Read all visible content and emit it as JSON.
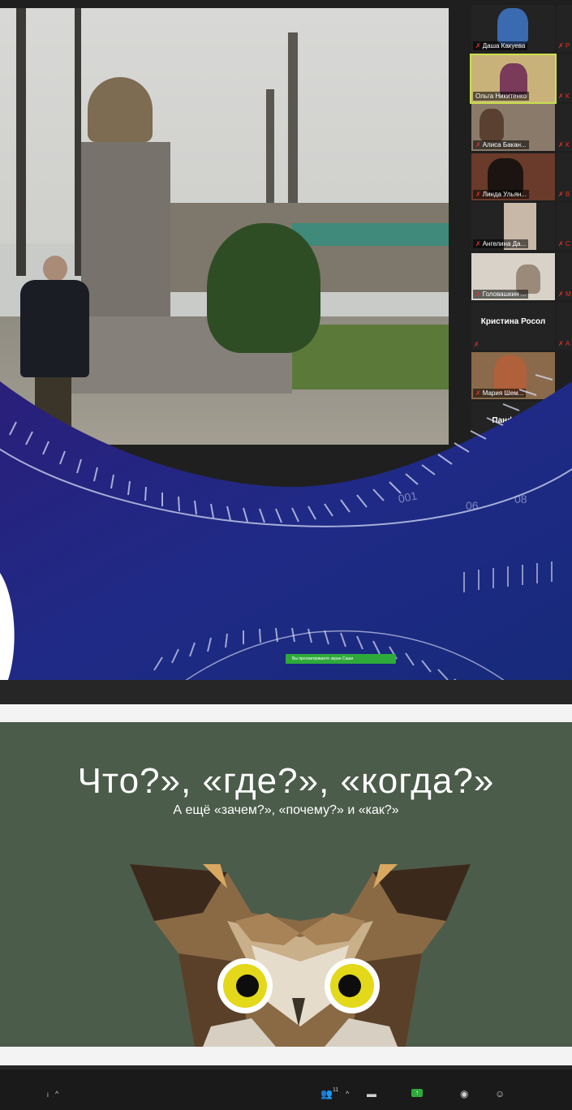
{
  "participants": [
    {
      "name": "Даша Какуева"
    },
    {
      "name": "Ольга Никитенко"
    },
    {
      "name": "Алиса Бакан..."
    },
    {
      "name": "Линда Ульян..."
    },
    {
      "name": "Ангелина Да..."
    },
    {
      "name": "Головашкин ..."
    },
    {
      "name": "Кристина Росол"
    },
    {
      "name": "Мария Шем..."
    },
    {
      "name": "Панфилов"
    }
  ],
  "right_column_initials": [
    "Р",
    "К",
    "К",
    "В",
    "С",
    "М",
    "А",
    "",
    ""
  ],
  "share_notice": "Вы просматриваете экран Саши",
  "slide": {
    "title": "Что?», «где?», «когда?»",
    "subtitle": "А ещё «зачем?», «почему?» и «как?»"
  },
  "toolbar": {
    "participants_count": "11",
    "icons": [
      "chevron-up-icon",
      "participants-icon",
      "chat-icon",
      "share-screen-icon",
      "record-icon",
      "reactions-icon"
    ]
  },
  "colors": {
    "background_blue": "#1a1f6e",
    "slide_green": "#4b5c4a",
    "share_green": "#2eaa3a",
    "active_border": "#c8e04a",
    "mic_muted": "#e0332b"
  }
}
